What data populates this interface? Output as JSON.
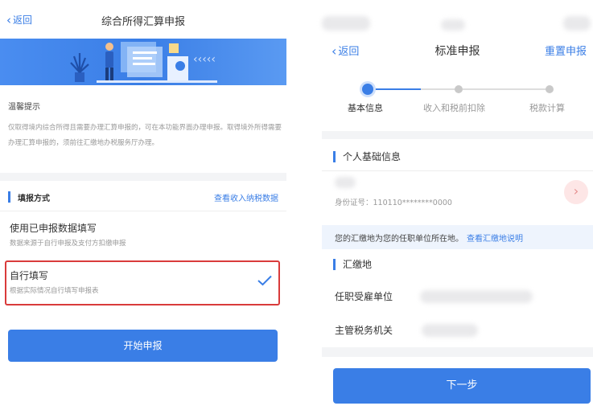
{
  "left": {
    "nav": {
      "back_label": "返回",
      "title": "综合所得汇算申报"
    },
    "tip": {
      "title": "温馨提示",
      "text": "仅取得境内综合所得且需要办理汇算申报的，可在本功能界面办理申报。取得境外所得需要办理汇算申报的，须前往汇缴地办税服务厅办理。"
    },
    "fill_method": {
      "label": "填报方式",
      "link": "查看收入纳税数据"
    },
    "options": [
      {
        "title": "使用已申报数据填写",
        "subtitle": "数据来源于自行申报及支付方扣缴申报",
        "selected": false
      },
      {
        "title": "自行填写",
        "subtitle": "根据实际情况自行填写申报表",
        "selected": true
      }
    ],
    "start_button": "开始申报",
    "accent_color": "#3a7ee6",
    "highlight_color": "#d93b3b"
  },
  "right": {
    "nav": {
      "back_label": "返回",
      "title": "标准申报",
      "reset_label": "重置申报"
    },
    "steps": [
      {
        "label": "基本信息",
        "active": true
      },
      {
        "label": "收入和税前扣除",
        "active": false
      },
      {
        "label": "税款计算",
        "active": false
      }
    ],
    "basic_info": {
      "section_title": "个人基础信息",
      "id_label": "身份证号：",
      "id_value": "110110********0000"
    },
    "notice": {
      "text": "您的汇缴地为您的任职单位所在地。",
      "link": "查看汇缴地说明"
    },
    "remit": {
      "section_title": "汇缴地",
      "fields": [
        {
          "label": "任职受雇单位"
        },
        {
          "label": "主管税务机关"
        }
      ]
    },
    "next_button": "下一步"
  }
}
